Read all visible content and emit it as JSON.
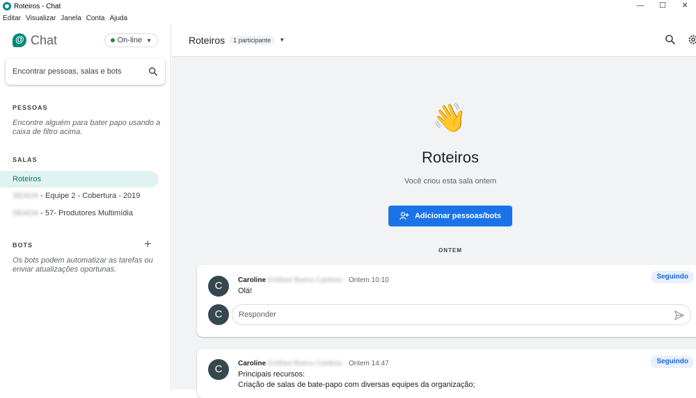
{
  "window": {
    "title": "Roteiros - Chat",
    "controls": [
      "—",
      "☐",
      "✕"
    ]
  },
  "menu": [
    "Editar",
    "Visualizar",
    "Janela",
    "Conta",
    "Ajuda"
  ],
  "sidebar": {
    "app_name": "Chat",
    "status": "On-line",
    "search_placeholder": "Encontrar pessoas, salas e bots",
    "people": {
      "title": "PESSOAS",
      "hint": "Encontre alguém para bater papo usando a caixa de filtro acima."
    },
    "rooms": {
      "title": "SALAS",
      "items": [
        {
          "prefix": "",
          "label": "Roteiros",
          "active": true
        },
        {
          "prefix": "SEADA",
          "label": "- Equipe 2 - Cobertura - 2019",
          "active": false
        },
        {
          "prefix": "SEADA",
          "label": "- 57- Produtores Multimídia",
          "active": false
        }
      ]
    },
    "bots": {
      "title": "BOTS",
      "add": "+",
      "hint": "Os bots podem automatizar as tarefas ou enviar atualizações oportunas."
    }
  },
  "main": {
    "room_title": "Roteiros",
    "participants": "1 participante",
    "hero": {
      "emoji": "👋",
      "title": "Roteiros",
      "subtitle": "Você criou esta sala ontem"
    },
    "add_button": "Adicionar pessoas/bots",
    "day_label": "ONTEM",
    "threads": [
      {
        "avatar": "C",
        "author": "Caroline",
        "author_hidden": "Emiliani Bueno Cardoso",
        "time": "Ontem 10:10",
        "lines": [
          "Olá!"
        ],
        "follow": "Seguindo",
        "reply_placeholder": "Responder"
      },
      {
        "avatar": "C",
        "author": "Caroline",
        "author_hidden": "Emiliani Bueno Cardoso",
        "time": "Ontem 14:47",
        "lines": [
          "Principais recursos:",
          "Criação de salas de bate-papo com diversas equipes da organização;"
        ],
        "follow": "Seguindo"
      }
    ]
  },
  "colors": {
    "accent": "#1a73e8",
    "brand": "#00897b",
    "online": "#1e8e3e",
    "avatar": "#37474f"
  }
}
